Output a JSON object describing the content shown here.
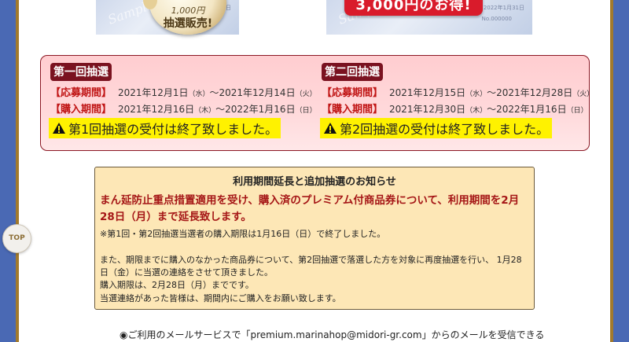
{
  "medal": {
    "line1": "1,000円",
    "line2": "抽選販売!"
  },
  "pink_tag": {
    "text": "3,000円のお得!"
  },
  "tickets": {
    "watermark": "Sample",
    "date": "2022年1月31日",
    "number": "No.000000"
  },
  "lottery": {
    "first": {
      "heading": "第一回抽選",
      "apply_label": "【応募期間】",
      "apply_start": "2021年12月1日",
      "apply_start_day": "（水）",
      "apply_end": "〜2021年12月14日",
      "apply_end_day": "（火）",
      "purchase_label": "【購入期間】",
      "purchase_start": "2021年12月16日",
      "purchase_start_day": "（木）",
      "purchase_end": "〜2022年1月16日",
      "purchase_end_day": "（日）",
      "notice": "第1回抽選の受付は終了致しました。"
    },
    "second": {
      "heading": "第二回抽選",
      "apply_label": "【応募期間】",
      "apply_start": "2021年12月15日",
      "apply_start_day": "（水）",
      "apply_end": "〜2021年12月28日",
      "apply_end_day": "（火）",
      "purchase_label": "【購入期間】",
      "purchase_start": "2021年12月30日",
      "purchase_start_day": "（木）",
      "purchase_end": "〜2022年1月16日",
      "purchase_end_day": "（日）",
      "notice": "第2回抽選の受付は終了致しました。"
    }
  },
  "info": {
    "title": "利用期間延長と追加抽選のお知らせ",
    "highlight": "まん延防止重点措置適用を受け、購入済のプレミアム付商品券について、利用期間を2月28日（月）まで延長致します。",
    "note1": "※第1回・第2回抽選当選者の購入期限は1月16日（日）で終了しました。",
    "para1": "また、期限までに購入のなかった商品券について、第2回抽選で落選した方を対象に再度抽選を行い、 1月28",
    "para2": "日（金）に当選の連絡をさせて頂きました。",
    "para3": "購入期限は、2月28日（月）までです。",
    "para4": "当選連絡があった皆様は、期間内にご購入をお願い致します。"
  },
  "top_button": {
    "label": "TOP"
  },
  "mail_note": "◉ご利用のメールサービスで「premium.marinahop@midori-gr.com」からのメールを受信できる",
  "colors": {
    "page_bg": "#4a69b4",
    "frame_gold": "#a27a2d",
    "lottery_border": "#8b1824",
    "label_red": "#c01414",
    "highlight_yellow": "#fff200",
    "info_bg": "#fde7b6"
  }
}
